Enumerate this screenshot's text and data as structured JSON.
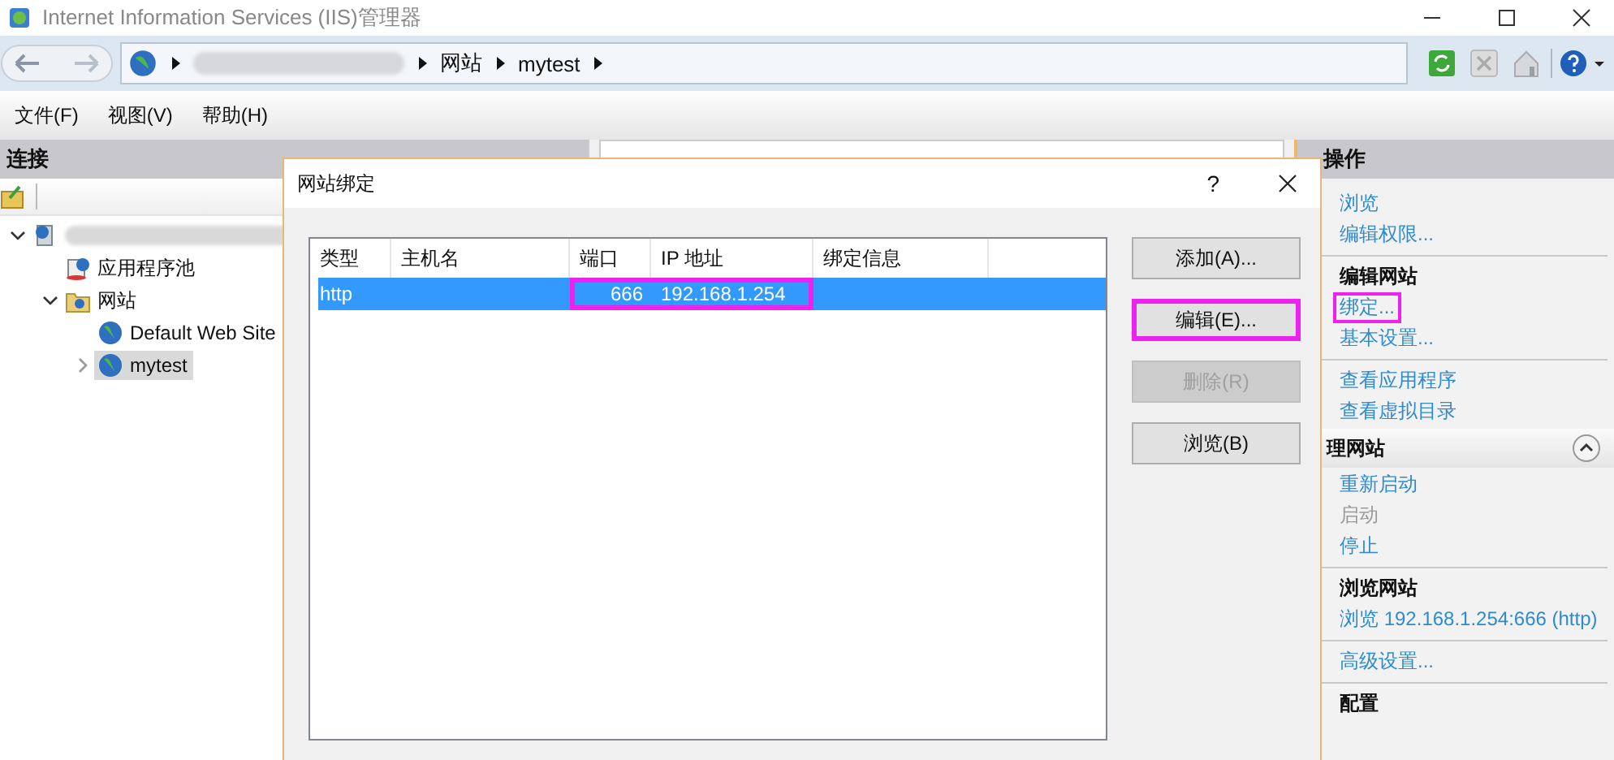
{
  "window": {
    "title": "Internet Information Services (IIS)管理器"
  },
  "address_bar": {
    "crumbs": [
      "网站",
      "mytest"
    ]
  },
  "menu": [
    "文件(F)",
    "视图(V)",
    "帮助(H)"
  ],
  "connections": {
    "title": "连接",
    "tree": [
      {
        "kind": "server",
        "expanded": true,
        "selected": false,
        "children": [
          {
            "kind": "pool",
            "label": "应用程序池",
            "selected": false
          },
          {
            "kind": "folder",
            "label": "网站",
            "expanded": true,
            "selected": false,
            "children": [
              {
                "kind": "site",
                "label": "Default Web Site",
                "selected": false
              },
              {
                "kind": "site",
                "label": "mytest",
                "expanded": false,
                "selected": true
              }
            ]
          }
        ]
      }
    ]
  },
  "dialog": {
    "title": "网站绑定",
    "help": "?",
    "columns": [
      "类型",
      "主机名",
      "端口",
      "IP 地址",
      "绑定信息"
    ],
    "rows": [
      {
        "selected": true,
        "cells": [
          {
            "text": "http",
            "highlighted": false
          },
          {
            "text": "",
            "highlighted": false
          },
          {
            "text": "666",
            "highlighted": true
          },
          {
            "text": "192.168.1.254",
            "highlighted": true
          },
          {
            "text": "",
            "highlighted": false
          }
        ]
      }
    ],
    "buttons": [
      {
        "label": "添加(A)...",
        "disabled": false,
        "highlighted": false
      },
      {
        "label": "编辑(E)...",
        "disabled": false,
        "highlighted": true
      },
      {
        "label": "删除(R)",
        "disabled": true,
        "highlighted": false
      },
      {
        "label": "浏览(B)",
        "disabled": false,
        "highlighted": false
      }
    ]
  },
  "actions": {
    "title": "操作",
    "items": [
      {
        "kind": "link",
        "text": "浏览",
        "disabled": false,
        "highlighted": false
      },
      {
        "kind": "link",
        "text": "编辑权限...",
        "disabled": false,
        "highlighted": false
      },
      {
        "kind": "divider"
      },
      {
        "kind": "heading",
        "text": "编辑网站"
      },
      {
        "kind": "link",
        "text": "绑定...",
        "disabled": false,
        "highlighted": true
      },
      {
        "kind": "link",
        "text": "基本设置...",
        "disabled": false,
        "highlighted": false
      },
      {
        "kind": "divider"
      },
      {
        "kind": "link",
        "text": "查看应用程序",
        "disabled": false,
        "highlighted": false
      },
      {
        "kind": "link",
        "text": "查看虚拟目录",
        "disabled": false,
        "highlighted": false
      },
      {
        "kind": "section",
        "text": "理网站"
      },
      {
        "kind": "link",
        "text": "重新启动",
        "disabled": false,
        "highlighted": false
      },
      {
        "kind": "link",
        "text": "启动",
        "disabled": true,
        "highlighted": false
      },
      {
        "kind": "link",
        "text": "停止",
        "disabled": false,
        "highlighted": false
      },
      {
        "kind": "divider"
      },
      {
        "kind": "heading",
        "text": "浏览网站"
      },
      {
        "kind": "link",
        "text": "浏览 192.168.1.254:666 (http)",
        "disabled": false,
        "highlighted": false
      },
      {
        "kind": "divider"
      },
      {
        "kind": "link",
        "text": "高级设置...",
        "disabled": false,
        "highlighted": false
      },
      {
        "kind": "divider"
      },
      {
        "kind": "heading",
        "text": "配置"
      }
    ]
  }
}
